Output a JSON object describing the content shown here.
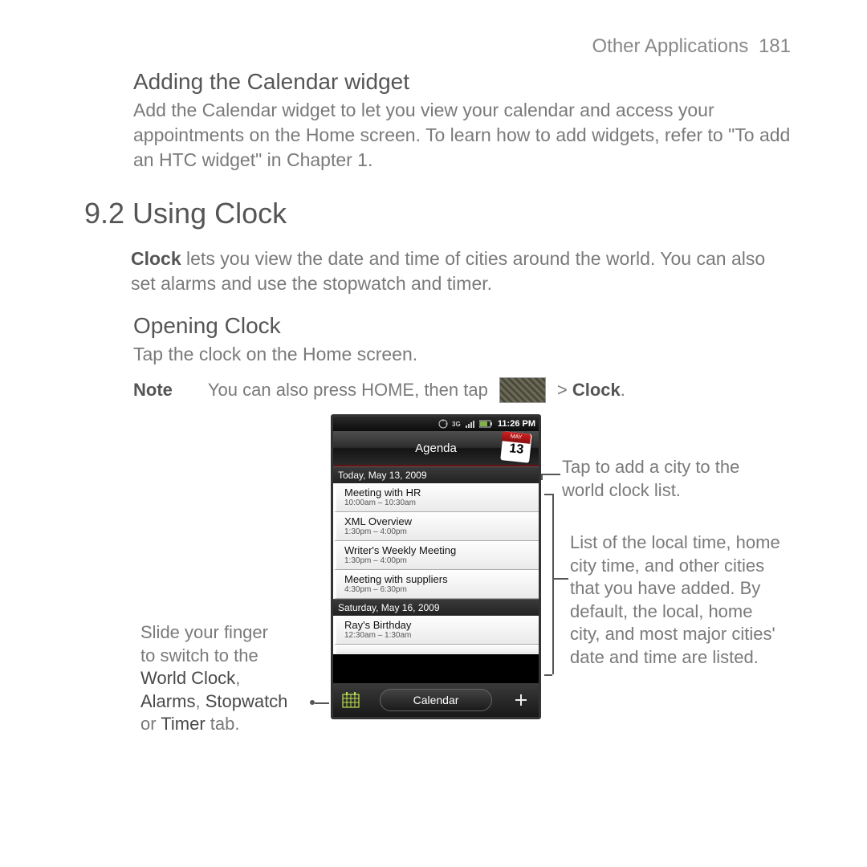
{
  "header": {
    "section": "Other Applications",
    "page": "181"
  },
  "widget": {
    "title": "Adding the Calendar widget",
    "body": "Add the Calendar widget to let you view your calendar and access your appointments on the Home screen. To learn how to add widgets, refer to \"To add an HTC widget\" in Chapter 1."
  },
  "clock": {
    "title": "9.2  Using Clock",
    "intro_pre": "Clock",
    "intro_rest": " lets you view the date and time of cities around the world. You can also set alarms and use the stopwatch and timer.",
    "opening_title": "Opening Clock",
    "opening_body": "Tap the clock on the Home screen.",
    "note_label": "Note",
    "note_pre": "You can also press HOME, then tap ",
    "note_post_pre": " > ",
    "note_post_bold": "Clock",
    "note_post_suffix": "."
  },
  "phone": {
    "status_time": "11:26 PM",
    "agenda_label": "Agenda",
    "cal_month": "MAY",
    "cal_day": "13",
    "day1": "Today, May 13, 2009",
    "events1": [
      {
        "title": "Meeting with HR",
        "time": "10:00am – 10:30am"
      },
      {
        "title": "XML Overview",
        "time": "1:30pm – 4:00pm"
      },
      {
        "title": "Writer's Weekly Meeting",
        "time": "1:30pm – 4:00pm"
      },
      {
        "title": "Meeting with suppliers",
        "time": "4:30pm – 6:30pm"
      }
    ],
    "day2": "Saturday, May 16, 2009",
    "events2": [
      {
        "title": "Ray's Birthday",
        "time": "12:30am – 1:30am"
      }
    ],
    "bottom_label": "Calendar"
  },
  "callouts": {
    "addcity": "Tap to add a city to the world clock list.",
    "list": "List of the local time, home city time, and other cities that you have added. By default, the local, home city, and most major cities' date and time are listed.",
    "slide_l1": "Slide your finger",
    "slide_l2": "to switch to the",
    "slide_l3a": "World Clock",
    "slide_l3b": ",",
    "slide_l4a": "Alarms",
    "slide_l4b": ", ",
    "slide_l4c": "Stopwatch",
    "slide_l5a": "or ",
    "slide_l5b": "Timer",
    "slide_l5c": " tab."
  }
}
